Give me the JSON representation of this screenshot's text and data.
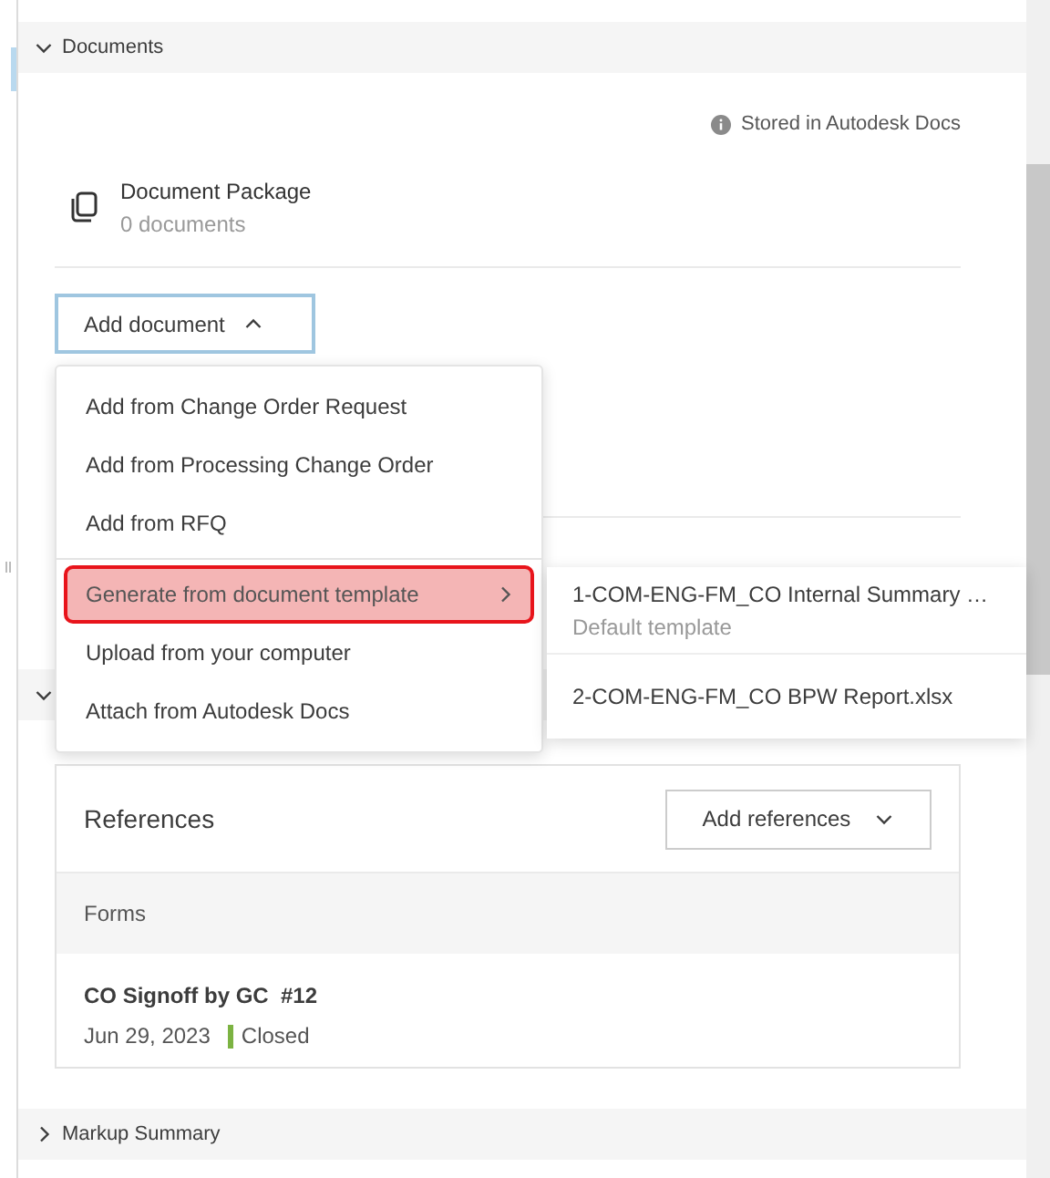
{
  "documents_section": {
    "title": "Documents",
    "expanded": true,
    "storage_note": "Stored in Autodesk Docs",
    "package": {
      "title": "Document Package",
      "count": "0 documents"
    },
    "add_button": {
      "label": "Add document",
      "expanded": true
    }
  },
  "add_menu": {
    "groups": [
      {
        "items": [
          {
            "label": "Add from Change Order Request",
            "selected": false,
            "has_submenu": false
          },
          {
            "label": "Add from Processing Change Order",
            "selected": false,
            "has_submenu": false
          },
          {
            "label": "Add from RFQ",
            "selected": false,
            "has_submenu": false
          }
        ]
      },
      {
        "items": [
          {
            "label": "Generate from document template",
            "selected": true,
            "has_submenu": true
          },
          {
            "label": "Upload from your computer",
            "selected": false,
            "has_submenu": false
          },
          {
            "label": "Attach from Autodesk Docs",
            "selected": false,
            "has_submenu": false
          }
        ]
      }
    ]
  },
  "submenu": {
    "items": [
      {
        "title": "1-COM-ENG-FM_CO Internal Summary …",
        "subtitle": "Default template"
      },
      {
        "title": "2-COM-ENG-FM_CO BPW Report.xlsx"
      }
    ]
  },
  "section_2": {
    "expanded": true
  },
  "references": {
    "title": "References",
    "add_button": "Add references",
    "groups": [
      {
        "title": "Forms",
        "items": [
          {
            "title": "CO Signoff by GC  #12",
            "date": "Jun 29, 2023",
            "status": "Closed",
            "color": "#7cb342"
          }
        ]
      }
    ]
  },
  "markup_section": {
    "title": "Markup Summary",
    "expanded": false
  }
}
